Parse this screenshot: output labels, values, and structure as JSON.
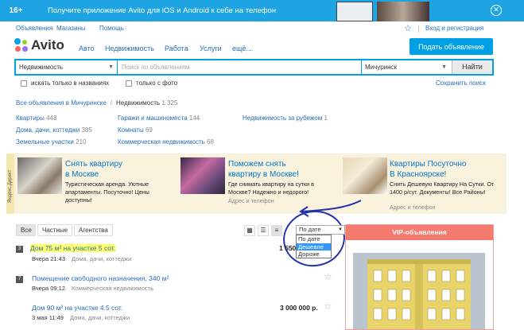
{
  "promo": {
    "age": "16+",
    "text": "Получите приложение Avito для iOS и Android к себе на телефон",
    "close": "✕"
  },
  "header": {
    "links": [
      "Объявления",
      "Магазины",
      "Помощь"
    ],
    "auth": "Вход и регистрация",
    "logo": "Avito",
    "nav": [
      "Авто",
      "Недвижимость",
      "Работа",
      "Услуги",
      "ещё..."
    ],
    "post_button": "Подать объявление"
  },
  "search": {
    "category": "Недвижимость",
    "placeholder": "Поиск по объявлениям",
    "city": "Мичуринск",
    "find": "Найти",
    "only_titles": "искать только в названиях",
    "only_photo": "только с фото",
    "save": "Сохранить поиск"
  },
  "breadcrumb": {
    "root": "Все объявления в Мичуринске",
    "current": "Недвижимость",
    "count": "1 325"
  },
  "categories": [
    {
      "name": "Квартиры",
      "count": "448"
    },
    {
      "name": "Дома, дачи, коттеджи",
      "count": "385"
    },
    {
      "name": "Земельные участки",
      "count": "210"
    },
    {
      "name": "Гаражи и машиноместа",
      "count": "144"
    },
    {
      "name": "Комнаты",
      "count": "69"
    },
    {
      "name": "Коммерческая недвижимость",
      "count": "68"
    },
    {
      "name": "Недвижимость за рубежом",
      "count": "1"
    }
  ],
  "ads": {
    "side_label": "Яндекс.Директ",
    "items": [
      {
        "title1": "Снять квартиру",
        "title2": "в Москве",
        "body": "Туристическая аренда. Уютные апартаменты. Посуточно! Цены доступны!",
        "addr": ""
      },
      {
        "title1": "Поможем снять",
        "title2": "квартиру в Москве!",
        "body": "Где снимать квартиру на сутки в Москве? Надежно и недорого!",
        "addr": "Адрес и телефон"
      },
      {
        "title1": "Квартиры Посуточно",
        "title2": "В Красноярске!",
        "body": "Снять Дешевую Квартиру На Сутки. От 1400 р/сут. Документы! Все Районы!",
        "addr": "Адрес и телефон"
      }
    ]
  },
  "filters": {
    "tabs": [
      "Все",
      "Частные",
      "Агентства"
    ],
    "sort": "По дате",
    "sort_options": [
      "По дате",
      "Дешевле",
      "Дороже"
    ]
  },
  "listings": [
    {
      "num": "3",
      "title": "Дом 75 м² на участке 5 сот.",
      "date": "Вчера 21:43",
      "cat": "Дома, дачи, коттеджи",
      "price": "1 550"
    },
    {
      "num": "7",
      "title": "Помещение свободного назначения, 340 м²",
      "date": "Вчера 09:12",
      "cat": "Коммерческая недвижимость",
      "price": ""
    },
    {
      "num": "",
      "title": "Дом 90 м² на участке 4.5 сот.",
      "date": "3 мая 11:49",
      "cat": "Дома, дачи, коттеджи",
      "price": "3 000 000 р."
    }
  ],
  "vip": {
    "title": "VIP-объявления"
  }
}
